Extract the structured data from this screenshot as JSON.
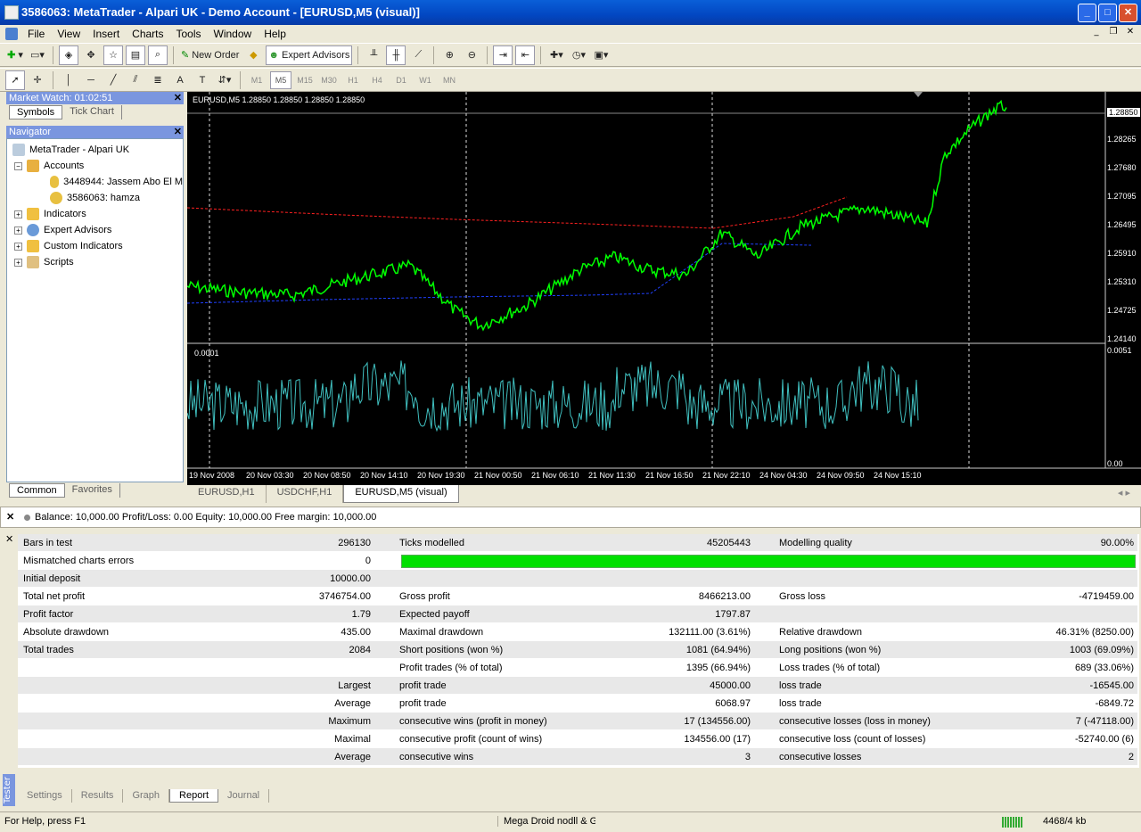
{
  "window": {
    "title": "3586063: MetaTrader - Alpari UK - Demo Account - [EURUSD,M5 (visual)]"
  },
  "menu": [
    "File",
    "View",
    "Insert",
    "Charts",
    "Tools",
    "Window",
    "Help"
  ],
  "toolbar": {
    "new_order": "New Order",
    "expert_advisors": "Expert Advisors"
  },
  "timeframes": [
    "M1",
    "M5",
    "M15",
    "M30",
    "H1",
    "H4",
    "D1",
    "W1",
    "MN"
  ],
  "market_watch": {
    "title": "Market Watch: 01:02:51",
    "tabs": [
      "Symbols",
      "Tick Chart"
    ]
  },
  "navigator": {
    "title": "Navigator",
    "root": "MetaTrader - Alpari UK",
    "accounts_label": "Accounts",
    "accounts": [
      "3448944: Jassem Abo El M",
      "3586063: hamza"
    ],
    "items": [
      "Indicators",
      "Expert Advisors",
      "Custom Indicators",
      "Scripts"
    ],
    "tabs": [
      "Common",
      "Favorites"
    ]
  },
  "chart": {
    "header": "EURUSD,M5  1.28850 1.28850 1.28850 1.28850",
    "price_labels": [
      "1.28850",
      "1.28265",
      "1.27680",
      "1.27095",
      "1.26495",
      "1.25910",
      "1.25310",
      "1.24725",
      "1.24140"
    ],
    "sub_labels": {
      "left": "0.0001",
      "top": "0.0051",
      "bottom": "0.00"
    },
    "time_labels": [
      "19 Nov 2008",
      "20 Nov 03:30",
      "20 Nov 08:50",
      "20 Nov 14:10",
      "20 Nov 19:30",
      "21 Nov 00:50",
      "21 Nov 06:10",
      "21 Nov 11:30",
      "21 Nov 16:50",
      "21 Nov 22:10",
      "24 Nov 04:30",
      "24 Nov 09:50",
      "24 Nov 15:10"
    ],
    "colors": {
      "candles": "#00ff00",
      "ma_red": "#ff2020",
      "ma_blue": "#2040ff",
      "volume": "#40c0c0"
    }
  },
  "chart_tabs": [
    "EURUSD,H1",
    "USDCHF,H1",
    "EURUSD,M5 (visual)"
  ],
  "balance_line": "Balance: 10,000.00  Profit/Loss: 0.00  Equity: 10,000.00  Free margin: 10,000.00",
  "report": {
    "rows": [
      [
        "Bars in test",
        "296130",
        "Ticks modelled",
        "45205443",
        "Modelling quality",
        "90.00%"
      ],
      [
        "Mismatched charts errors",
        "0",
        "",
        "",
        "",
        ""
      ],
      [
        "Initial deposit",
        "10000.00",
        "",
        "",
        "",
        ""
      ],
      [
        "Total net profit",
        "3746754.00",
        "Gross profit",
        "8466213.00",
        "Gross loss",
        "-4719459.00"
      ],
      [
        "Profit factor",
        "1.79",
        "Expected payoff",
        "1797.87",
        "",
        ""
      ],
      [
        "Absolute drawdown",
        "435.00",
        "Maximal drawdown",
        "132111.00 (3.61%)",
        "Relative drawdown",
        "46.31% (8250.00)"
      ],
      [
        "Total trades",
        "2084",
        "Short positions (won %)",
        "1081 (64.94%)",
        "Long positions (won %)",
        "1003 (69.09%)"
      ],
      [
        "",
        "",
        "Profit trades (% of total)",
        "1395 (66.94%)",
        "Loss trades (% of total)",
        "689 (33.06%)"
      ],
      [
        "",
        "Largest",
        "profit trade",
        "45000.00",
        "loss trade",
        "-16545.00"
      ],
      [
        "",
        "Average",
        "profit trade",
        "6068.97",
        "loss trade",
        "-6849.72"
      ],
      [
        "",
        "Maximum",
        "consecutive wins (profit in money)",
        "17 (134556.00)",
        "consecutive losses (loss in money)",
        "7 (-47118.00)"
      ],
      [
        "",
        "Maximal",
        "consecutive profit (count of wins)",
        "134556.00 (17)",
        "consecutive loss (count of losses)",
        "-52740.00 (6)"
      ],
      [
        "",
        "Average",
        "consecutive wins",
        "3",
        "consecutive losses",
        "2"
      ]
    ]
  },
  "tester_tabs": [
    "Settings",
    "Results",
    "Graph",
    "Report",
    "Journal"
  ],
  "tester_label": "Tester",
  "status": {
    "help": "For Help, press F1",
    "profile": "Mega Droid nodll & Gt",
    "traffic": "4468/4 kb"
  }
}
